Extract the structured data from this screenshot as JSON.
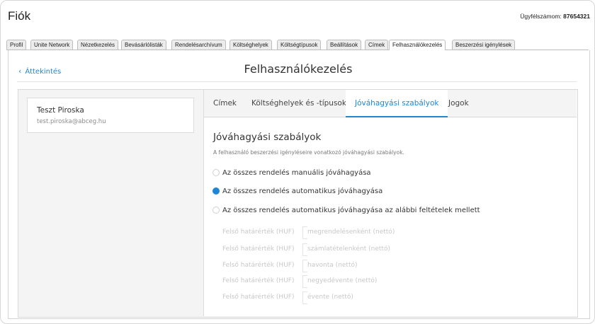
{
  "header": {
    "title": "Fiók",
    "customer_label": "Ügyfélszámom:",
    "customer_number": "87654321"
  },
  "tabs": [
    {
      "label": "Profil"
    },
    {
      "label": "Unite Network"
    },
    {
      "label": "Nézetkezelés"
    },
    {
      "label": "Bevásárlólisták"
    },
    {
      "label": "Rendelésarchívum"
    },
    {
      "label": "Költséghelyek"
    },
    {
      "label": "Költségtípusok"
    },
    {
      "label": "Beállítások"
    },
    {
      "label": "Címek"
    },
    {
      "label": "Felhasználókezelés",
      "active": true
    },
    {
      "label": "Beszerzési igénylések"
    }
  ],
  "page": {
    "back_label": "Áttekintés",
    "title": "Felhasználókezelés"
  },
  "user": {
    "name": "Teszt Piroska",
    "email": "test.piroska@abceg.hu"
  },
  "subtabs": [
    {
      "label": "Címek"
    },
    {
      "label": "Költséghelyek és -típusok"
    },
    {
      "label": "Jóváhagyási szabályok",
      "active": true
    },
    {
      "label": "Jogok"
    }
  ],
  "section": {
    "title": "Jóváhagyási szabályok",
    "description": "A felhasználó beszerzési igényléseire vonatkozó jóváhagyási szabályok."
  },
  "options": [
    {
      "label": "Az összes rendelés manuális jóváhagyása",
      "selected": false
    },
    {
      "label": "Az összes rendelés automatikus jóváhagyása",
      "selected": true
    },
    {
      "label": "Az összes rendelés automatikus jóváhagyása az alábbi feltételek mellett",
      "selected": false
    }
  ],
  "limits": [
    {
      "label": "Felső határérték (HUF)",
      "suffix": "megrendelésenként (nettó)"
    },
    {
      "label": "Felső határérték (HUF)",
      "suffix": "számlatételenként (nettó)"
    },
    {
      "label": "Felső határérték (HUF)",
      "suffix": "havonta (nettó)"
    },
    {
      "label": "Felső határérték (HUF)",
      "suffix": "negyedévente (nettó)"
    },
    {
      "label": "Felső határérték (HUF)",
      "suffix": "évente (nettó)"
    }
  ],
  "colors": {
    "accent": "#1f86d6",
    "tab_background": "#ececec",
    "disabled_text": "#c8c8c8"
  }
}
